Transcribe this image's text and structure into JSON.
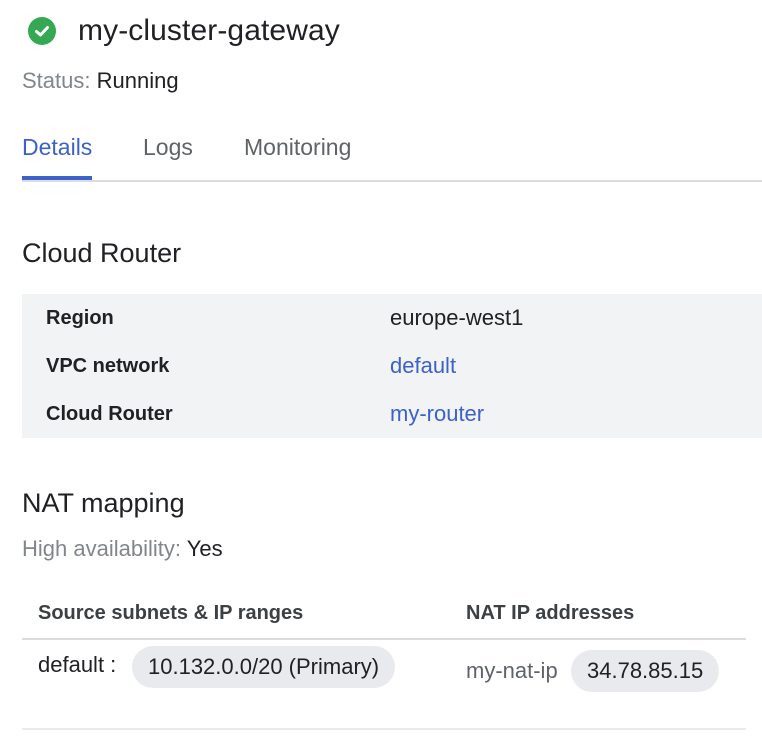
{
  "header": {
    "title": "my-cluster-gateway",
    "status_label": "Status:",
    "status_value": "Running",
    "status_color": "#34a853"
  },
  "tabs": [
    {
      "label": "Details",
      "active": true
    },
    {
      "label": "Logs",
      "active": false
    },
    {
      "label": "Monitoring",
      "active": false
    }
  ],
  "cloud_router": {
    "title": "Cloud Router",
    "rows": [
      {
        "key": "Region",
        "value": "europe-west1",
        "link": false
      },
      {
        "key": "VPC network",
        "value": "default",
        "link": true
      },
      {
        "key": "Cloud Router",
        "value": "my-router",
        "link": true
      }
    ]
  },
  "nat_mapping": {
    "title": "NAT mapping",
    "ha_label": "High availability:",
    "ha_value": "Yes",
    "columns": [
      "Source subnets & IP ranges",
      "NAT IP addresses"
    ],
    "rows": [
      {
        "subnet": "default :",
        "range": "10.132.0.0/20 (Primary)",
        "nat_name": "my-nat-ip",
        "nat_ip": "34.78.85.15"
      }
    ]
  },
  "colors": {
    "accent": "#3c62c9",
    "text": "#202124",
    "muted": "#80868b",
    "table_bg": "#f1f3f4",
    "chip_bg": "#e8eaed"
  }
}
